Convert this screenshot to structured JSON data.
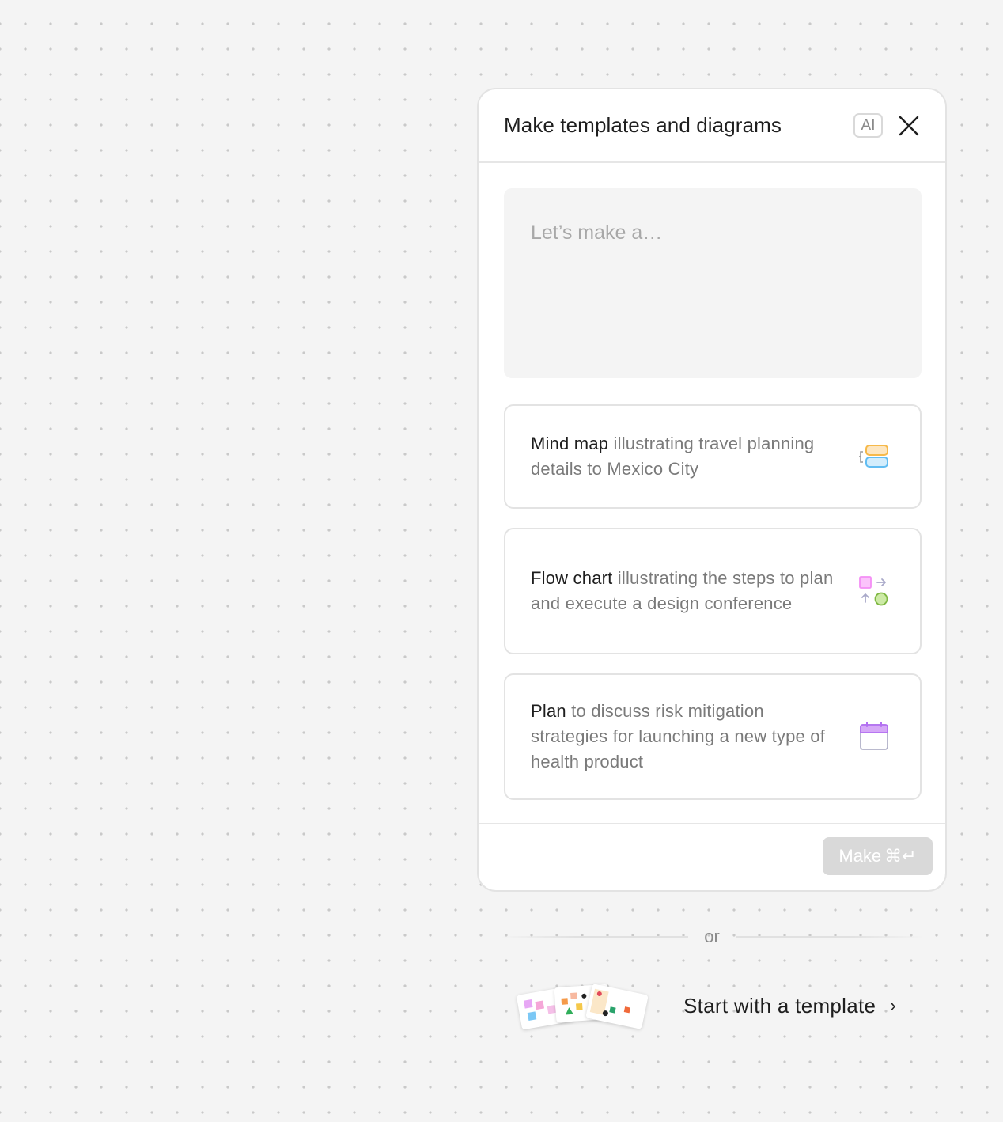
{
  "panel": {
    "title": "Make templates and diagrams",
    "ai_badge": "AI",
    "close_icon": "close-icon"
  },
  "prompt": {
    "placeholder": "Let’s make a…",
    "value": ""
  },
  "suggestions": [
    {
      "keyword": "Mind map",
      "text": " illustrating travel planning details to Mexico City",
      "icon": "mind-map-icon"
    },
    {
      "keyword": "Flow chart",
      "text": " illustrating the steps to plan and execute a design conference",
      "icon": "flow-chart-icon"
    },
    {
      "keyword": "Plan",
      "text": " to discuss risk mitigation strategies for launching a new type of health product",
      "icon": "calendar-icon"
    }
  ],
  "footer": {
    "make_label": "Make",
    "make_shortcut": "⌘↵",
    "make_enabled": false
  },
  "divider": {
    "or_text": "or"
  },
  "template": {
    "label": "Start with a template",
    "chevron": "›",
    "thumbnail_icon": "template-thumbnails"
  },
  "colors": {
    "background": "#f4f4f4",
    "panel": "#ffffff",
    "border": "#e3e3e3",
    "input_bg": "#f4f4f4",
    "muted_text": "#7a7a7a",
    "button_disabled": "#d9d9d9",
    "mind_map_orange": "#f6b94a",
    "mind_map_blue": "#62bdf2",
    "flow_pink": "#f48ef5",
    "flow_green": "#a6d96a",
    "calendar_purple": "#b36ff2"
  }
}
